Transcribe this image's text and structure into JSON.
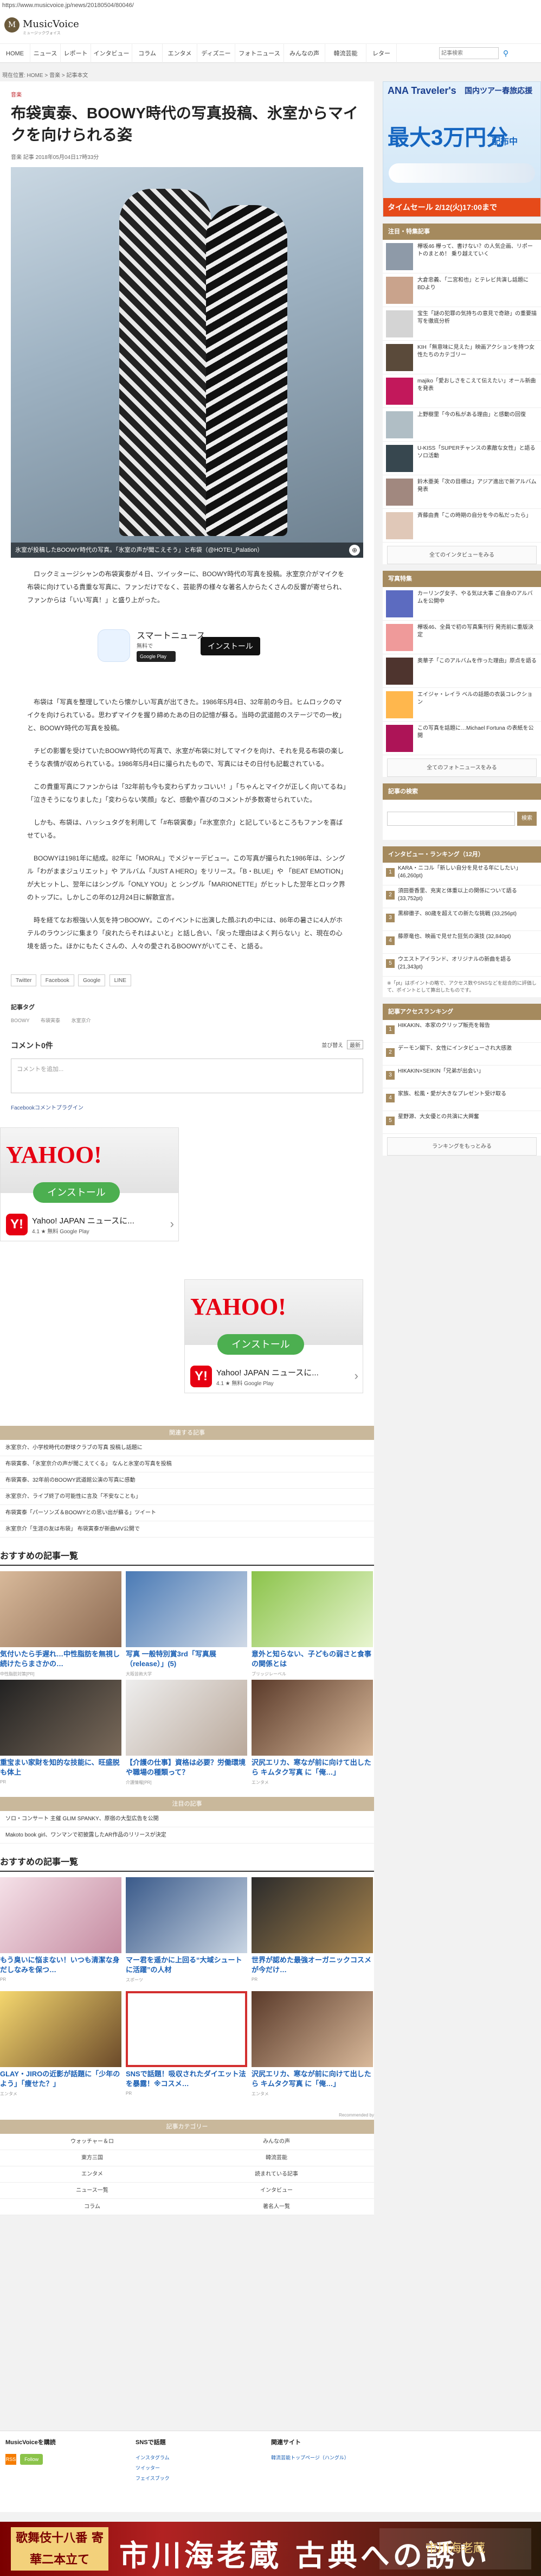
{
  "url": "https://www.musicvoice.jp/news/20180504/80046/",
  "logo": {
    "mark": "M",
    "name": "MusicVoice",
    "tagline": "ミュージックヴォイス"
  },
  "nav": {
    "items": [
      "HOME",
      "ニュース",
      "レポート",
      "インタビュー",
      "コラム",
      "エンタメ",
      "ディズニー",
      "フォトニュース",
      "みんなの声",
      "韓流芸能",
      "レター"
    ],
    "search_placeholder": "記事検索"
  },
  "breadcrumb": "現在位置: HOME > 音楽 > 記事本文",
  "article": {
    "category": "音楽",
    "title": "布袋寅泰、BOOWY時代の写真投稿、氷室からマイクを向けられる姿",
    "meta": "音楽 記事 2018年05月04日17時33分",
    "hero_caption": "氷室が投稿したBOOWY時代の写真。「氷室の声が聞こえそう」と布袋（@HOTEI_Palation）",
    "paragraphs": [
      "ロックミュージシャンの布袋寅泰が４日、ツイッターに、BOOWY時代の写真を投稿。氷室京介がマイクを布袋に向けている貴重な写真に、ファンだけでなく、芸能界の様々な著名人からたくさんの反響が寄せられ、ファンからは「いい写真！」と盛り上がった。",
      "布袋は「写真を整理していたら懐かしい写真が出てきた。1986年5月4日、32年前の今日。ヒムロックのマイクを向けられている。思わずマイクを握り締めたあの日の記憶が蘇る。当時の武道館のステージでの一枚」と、BOOWY時代の写真を投稿。",
      "チビの影響を受けていたBOOWY時代の写真で、氷室が布袋に対してマイクを向け、それを見る布袋の楽しそうな表情が収められている。1986年5月4日に撮られたもので、写真にはその日付も記載されている。",
      "この貴重写真にファンからは「32年前も今も変わらずカッコいい！」「ちゃんとマイクが正しく向いてるね」「泣きそうになりました」「変わらない笑顔」など、感動や喜びのコメントが多数寄せられていた。",
      "しかも、布袋は、ハッシュタグを利用して「#布袋寅泰」「#氷室京介」と記しているところもファンを喜ばせている。",
      "BOOWYは1981年に結成。82年に「MORAL」でメジャーデビュー。この写真が撮られた1986年は、シングル「わがままジュリエット」や アルバム「JUST A HERO」をリリース。「B・BLUE」や 「BEAT EMOTION」が大ヒットし、翌年にはシングル「ONLY YOU」と シングル「MARIONETTE」がヒットした翌年とロック界のトップに。しかしこの年の12月24日に解散宣言。",
      "時を経てなお根強い人気を持つBOOWY。このイベントに出演した顔ぶれの中には、86年の暑さに4人がホテルのラウンジに集まり「戻れたらそれはよいと」と話し合い、「戻った理由はよく判らない」と、現在の心境を語った。ほかにもたくさんの、人々の愛されるBOOWYがいてこそ、と語る。"
    ],
    "app_ad": {
      "name": "スマートニュース",
      "free": "無料で",
      "store": "Google Play",
      "install": "インストール"
    },
    "share_buttons": [
      "Twitter",
      "Facebook",
      "Google",
      "LINE"
    ],
    "tags_head": "記事タグ",
    "tags": [
      "BOOWY",
      "布袋寅泰",
      "氷室京介"
    ],
    "comments": {
      "count_label": "コメント0件",
      "sort_label": "並び替え",
      "sort_value": "最新",
      "placeholder": "コメントを追加...",
      "plugin": "Facebookコメントプラグイン"
    }
  },
  "yj_ads": [
    {
      "logo": "YAHOO!",
      "install": "インストール",
      "name": "Yahoo! JAPAN ニュースに...",
      "rating": "4.1 ★ 無料 Google Play"
    },
    {
      "logo": "YAHOO!",
      "install": "インストール",
      "name": "Yahoo! JAPAN ニュースに...",
      "rating": "4.1 ★ 無料 Google Play"
    }
  ],
  "related": {
    "head": "関連する記事",
    "items": [
      "氷室京介、小学校時代の野球クラブの写真 投稿し話題に",
      "布袋寅泰、「氷室京介の声が聞こえてくる」 なんと氷室の写真を投稿",
      "布袋寅泰、32年前のBOOWY武道館公演の写真に感動",
      "氷室京介、ライブ終了の可能性に言及「不安なことも」",
      "布袋寅泰「パーソンズ＆BOOWYとの思い出が蘇る」ツイート",
      "氷室京介「生涯の友は布袋」 布袋寅泰が新曲MV公開で"
    ]
  },
  "osusume1": {
    "title": "おすすめの記事一覧",
    "cards": [
      {
        "title": "気付いたら手遅れ…中性脂肪を無視し続けたらまさかの…",
        "src": "中性脂肪対策[PR]"
      },
      {
        "title": "写真 一般特別賞3rd「写真展（release）」(5)",
        "src": "大阪芸術大学"
      },
      {
        "title": "意外と知らない、子どもの弱さと食事の関係とは",
        "src": "ブリッジレーベル"
      },
      {
        "title": "重宝まい家財を知的な技能に、旺盛脱も体上",
        "src": "PR"
      },
      {
        "title": "【介護の仕事】資格は必要？労働環境や職場の種類って？",
        "src": "介護情報[PR]"
      },
      {
        "title": "沢尻エリカ、寒なが前に向けて出したら キムタク写真 に「俺…」",
        "src": "エンタメ"
      }
    ]
  },
  "mid_links": {
    "head": "注目の記事",
    "items": [
      "ソロ・コンサート 主催 GLIM SPANKY、原宿の大型広告を公開",
      "Makoto book girl、ワンマンで初披露したAR作品のリリースが決定"
    ]
  },
  "osusume2": {
    "title": "おすすめの記事一覧",
    "cards": [
      {
        "title": "もう臭いに悩まない！いつも清潔な身だしなみを保つ…",
        "src": "PR"
      },
      {
        "title": "マー君を遥かに上回る“大域シュートに活躍”の人材",
        "src": "スポーツ"
      },
      {
        "title": "世界が認めた最強オーガニックコスメが今だけ…",
        "src": "PR"
      },
      {
        "title": "GLAY・JIROの近影が話題に「少年のよう」「痩せた？」",
        "src": "エンタメ"
      },
      {
        "title": "SNSで話題！吸収されたダイエット法を暴露！※コスメ…",
        "src": "PR"
      },
      {
        "title": "沢尻エリカ、寒なが前に向けて出したら キムタク写真 に「俺…」",
        "src": "エンタメ"
      }
    ],
    "credit": "Recommended by"
  },
  "footer_links": {
    "head": "記事カテゴリー",
    "rows": [
      [
        "ウォッチャー＆ロ",
        "みんなの声"
      ],
      [
        "東方三国",
        "韓流芸能"
      ],
      [
        "エンタメ",
        "読まれている記事"
      ],
      [
        "ニュース一覧",
        "インタビュー"
      ],
      [
        "コラム",
        "著名人一覧"
      ]
    ]
  },
  "sidebar": {
    "banner": {
      "brand": "ANA Traveler's",
      "sub": "国内ツアー春旅応援",
      "headline": "最大3万円分",
      "coupon": "配布中",
      "timesale": "タイムセール 2/12(火)17:00まで"
    },
    "attention": {
      "head": "注目・特集記事",
      "items": [
        "欅坂46 欅って、書けない？の人気企画、リポートのまとめ！ 乗り越えていく",
        "大倉忠義、「二宮和也」とテレビ共演し話題に BDより",
        "宝生「謎の犯罪の気持ちの意見で奇跡」の重要描写を徹底分析",
        "KIH「無意味に見えた」映画アクションを持つ女性たちのカテゴリー",
        "majiko「愛おしさをこえて伝えたい」オール新曲を発表",
        "上野樹里「今の私がある理由」と感動の回復",
        "U-KISS「SUPERチャンスの素敵な女性」と語るソロ活動",
        "鈴木亜美「次の目標は」アジア進出で新アルバム発表",
        "斉藤由貴「この時期の自分を今の私だったら」"
      ],
      "more": "全てのインタビューをみる"
    },
    "photos": {
      "head": "写真特集",
      "items": [
        "カーリング女子、やる気は大事 ご自身のアルバムを公開中",
        "欅坂46、全員で初の写真集刊行 発売前に重版決定",
        "奥華子「このアルバムを作った理由」原点を語る",
        "エイジャ・レイラ ベルの話題の衣装コレクション",
        "この写真を話題に…Michael Fortuna の表紙を公開"
      ],
      "more": "全てのフォトニュースをみる"
    },
    "search": {
      "head": "記事の検索",
      "button": "検索"
    },
    "ranking": {
      "head": "インタビュー・ランキング（12月）",
      "items": [
        "KARA・ニコル「新しい自分を見せる年にしたい」 (46,260pt)",
        "須田亜香里、充実と体重以上の関係について語る (33,752pt)",
        "黒柳徹子、80歳を超えての新たな挑戦 (33,256pt)",
        "藤原竜也、映画で見せた狂気の演技 (32,840pt)",
        "ウエストアイランド、オリジナルの新曲を語る (21,343pt)"
      ],
      "note": "※「pt」はポイントの略で、アクセス数やSNSなどを総合的に評価して、ポイントとして算出したものです。"
    },
    "access": {
      "head": "記事アクセスランキング",
      "items": [
        "HIKAKIN、本家のクリップ販売を報告",
        "デーモン閣下、女性にインタビューされ大感激",
        "HIKAKIN×SEIKIN「兄弟が出会い」",
        "家族、松風・愛が大きなプレゼント受け取る",
        "星野源、大女優との共演に大興奮"
      ],
      "more": "ランキングをもっとみる"
    }
  },
  "footer": {
    "col1": {
      "head": "MusicVoiceを購読",
      "items": [
        "RSS",
        "Follow"
      ]
    },
    "col2": {
      "head": "SNSで話題",
      "items": [
        "インスタグラム",
        "ツイッター",
        "フェイスブック"
      ]
    },
    "col3": {
      "head": "関連サイト",
      "items": [
        "韓流芸能トップページ（ハングル）"
      ]
    }
  },
  "bottom_ad": {
    "left": "歌舞伎十八番 寄華二本立て",
    "mid": "市川海老蔵 古典への誘い",
    "right": "市川海老蔵"
  }
}
